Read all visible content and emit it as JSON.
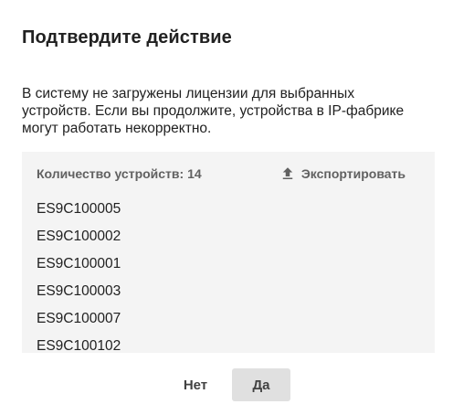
{
  "dialog": {
    "title": "Подтвердите действие",
    "message": "В систему не загружены лицензии для выбранных устройств. Если вы продолжите, устройства в IP-фабрике могут работать некорректно.",
    "panel": {
      "count_label": "Количество устройств: 14",
      "export_label": "Экспортировать",
      "export_icon": "upload-icon",
      "devices": [
        "ES9C100005",
        "ES9C100002",
        "ES9C100001",
        "ES9C100003",
        "ES9C100007",
        "ES9C100102"
      ]
    },
    "actions": {
      "no_label": "Нет",
      "yes_label": "Да"
    }
  }
}
